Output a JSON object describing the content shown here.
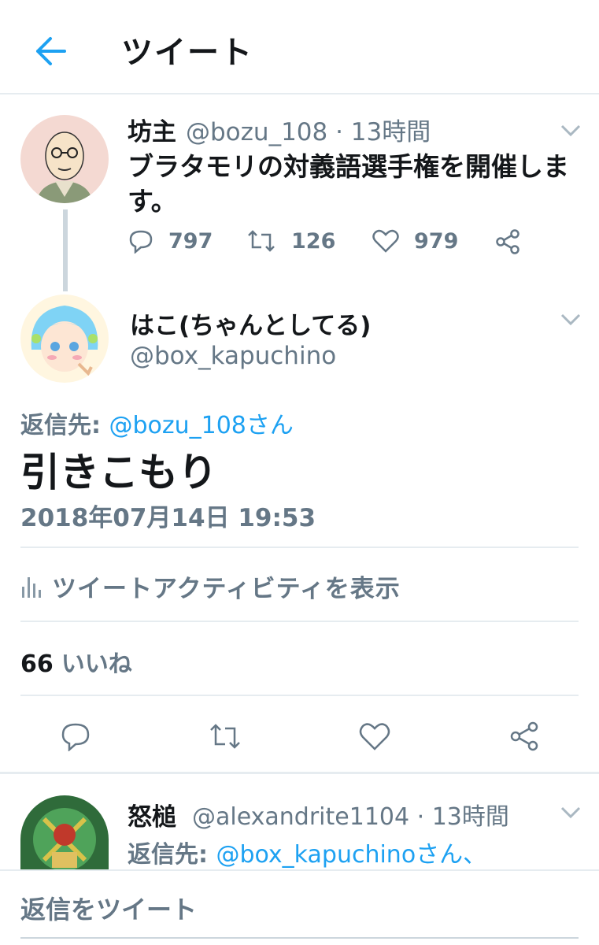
{
  "header": {
    "title": "ツイート"
  },
  "tweet1": {
    "name": "坊主",
    "meta": "@bozu_108 · 13時間",
    "text": "ブラタモリの対義語選手権を開催します。",
    "replies": "797",
    "retweets": "126",
    "likes": "979"
  },
  "tweet2": {
    "name": "はこ(ちゃんとしてる)",
    "handle": "@box_kapuchino",
    "reply_prefix": "返信先: ",
    "reply_to": "@bozu_108さん",
    "text": "引きこもり",
    "timestamp": "2018年07月14日 19:53",
    "activity_label": "ツイートアクティビティを表示",
    "like_count": "66",
    "like_label": "いいね"
  },
  "tweet3": {
    "name": "怒槌",
    "meta": "@alexandrite1104 · 13時間",
    "reply_prefix": "返信先: ",
    "reply_to": "@box_kapuchinoさん、"
  },
  "compose": {
    "placeholder": "返信をツイート"
  },
  "colors": {
    "accent": "#1da1f2",
    "muted": "#657786",
    "border": "#e6ecf0"
  }
}
